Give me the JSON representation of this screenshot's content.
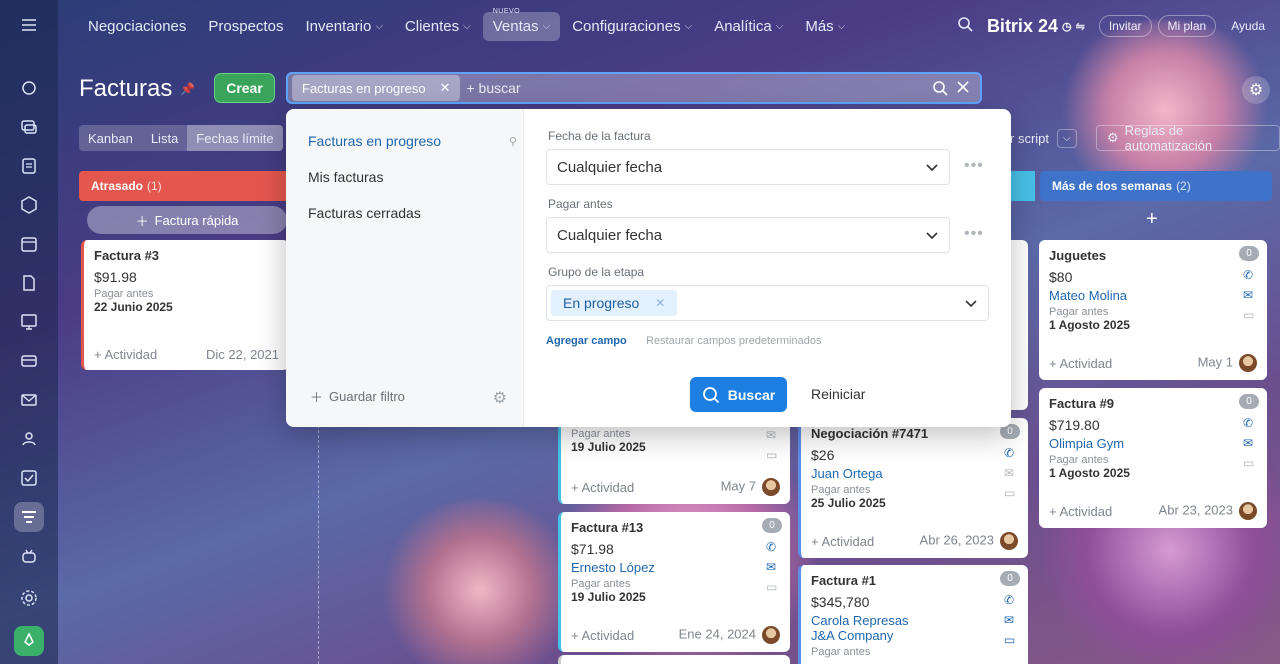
{
  "topnav": {
    "items": [
      {
        "label": "Negociaciones",
        "chevron": false
      },
      {
        "label": "Prospectos",
        "chevron": false
      },
      {
        "label": "Inventario",
        "chevron": true
      },
      {
        "label": "Clientes",
        "chevron": true
      },
      {
        "label": "Ventas",
        "chevron": true,
        "badge": "NUEVO",
        "active": true
      },
      {
        "label": "Configuraciones",
        "chevron": true
      },
      {
        "label": "Analítica",
        "chevron": true
      },
      {
        "label": "Más",
        "chevron": true
      }
    ],
    "brand": "Bitrix 24",
    "invite": "Invitar",
    "plan": "Mi plan",
    "help": "Ayuda"
  },
  "page": {
    "title": "Facturas",
    "create_label": "Crear"
  },
  "search": {
    "chip": "Facturas en progreso",
    "placeholder": "+ buscar"
  },
  "view_tabs": [
    "Kanban",
    "Lista",
    "Fechas límite"
  ],
  "toolbar": {
    "script_label": "r script",
    "rules_label": "Reglas de automatización"
  },
  "columns": [
    {
      "name": "Atrasado",
      "count": "(1)",
      "color": "#e4574e"
    },
    {
      "name": "Más de dos semanas",
      "count": "(2)",
      "color": "#3f73c9"
    }
  ],
  "quick_add": "Factura rápida",
  "cards": {
    "c1": {
      "title": "Factura #3",
      "amount": "$91.98",
      "label": "Pagar antes",
      "date": "22 Junio 2025",
      "activity": "+ Actividad",
      "footdate": "Dic 22, 2021"
    },
    "c2": {
      "label": "Pagar antes",
      "date": "19 Julio 2025",
      "activity": "+ Actividad",
      "footdate": "May 7"
    },
    "c3": {
      "title": "Factura #13",
      "badge": "0",
      "amount": "$71.98",
      "contact": "Ernesto López",
      "label": "Pagar antes",
      "date": "19 Julio 2025",
      "activity": "+ Actividad",
      "footdate": "Ene 24, 2024"
    },
    "c4": {
      "title": "Negociación #7471",
      "badge": "0",
      "amount": "$26",
      "contact": "Juan Ortega",
      "label": "Pagar antes",
      "date": "25 Julio 2025",
      "activity": "+ Actividad",
      "footdate": "Abr 26, 2023"
    },
    "c5": {
      "title": "Factura #1",
      "badge": "0",
      "amount": "$345,780",
      "contact": "Carola Represas",
      "company": "J&A Company",
      "label": "Pagar antes"
    },
    "c6": {
      "title": "Juguetes",
      "badge": "0",
      "amount": "$80",
      "contact": "Mateo Molina",
      "label": "Pagar antes",
      "date": "1 Agosto 2025",
      "activity": "+ Actividad",
      "footdate": "May 1"
    },
    "c7": {
      "title": "Factura #9",
      "badge": "0",
      "amount": "$719.80",
      "contact": "Olimpia Gym",
      "label": "Pagar antes",
      "date": "1 Agosto 2025",
      "activity": "+ Actividad",
      "footdate": "Abr 23, 2023"
    }
  },
  "filter": {
    "presets": [
      "Facturas en progreso",
      "Mis facturas",
      "Facturas cerradas"
    ],
    "save_filter": "Guardar filtro",
    "field1_label": "Fecha de la factura",
    "field1_value": "Cualquier fecha",
    "field2_label": "Pagar antes",
    "field2_value": "Cualquier fecha",
    "field3_label": "Grupo de la etapa",
    "field3_tag": "En progreso",
    "add_field": "Agregar campo",
    "restore_fields": "Restaurar campos predeterminados",
    "search_btn": "Buscar",
    "reset_btn": "Reiniciar"
  }
}
